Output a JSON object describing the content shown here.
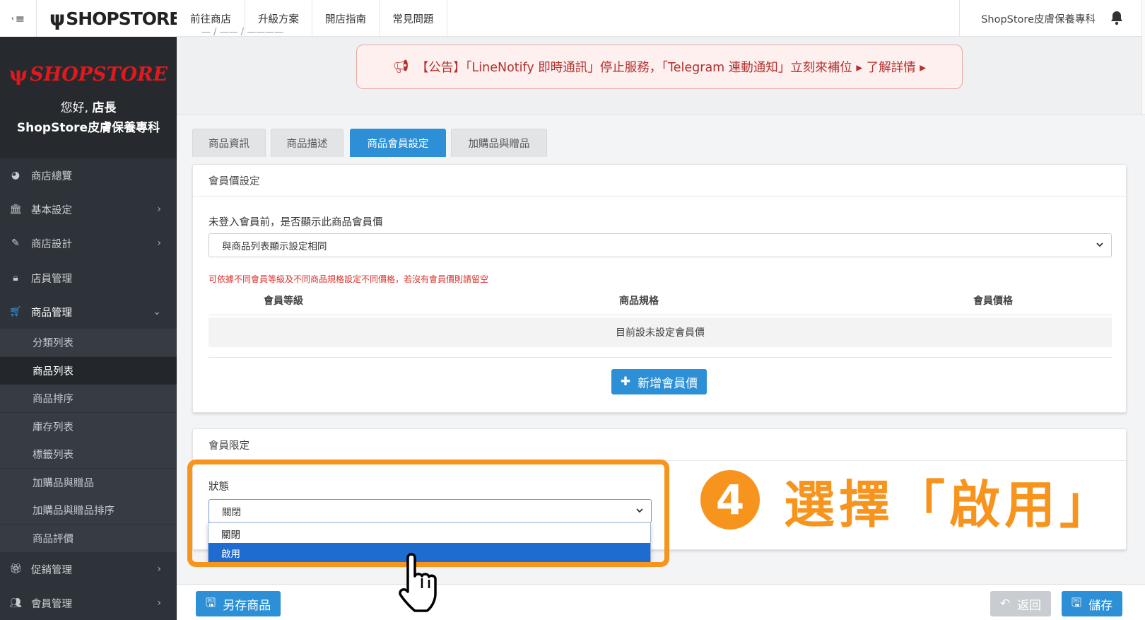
{
  "sidebar": {
    "toggle_icon": "menu-collapse-icon",
    "top_logo": "SHOPSTORE",
    "logo": "SHOPSTORE",
    "greeting": "您好,",
    "role": "店長",
    "shop_name": "ShopStore皮膚保養專科",
    "nav": [
      {
        "label": "商店總覽",
        "icon": "dashboard-icon"
      },
      {
        "label": "基本設定",
        "icon": "bank-icon"
      },
      {
        "label": "商店設計",
        "icon": "magic-wand-icon"
      },
      {
        "label": "店員管理",
        "icon": "lock-icon"
      },
      {
        "label": "商品管理",
        "icon": "cart-icon"
      }
    ],
    "sub": [
      {
        "label": "分類列表"
      },
      {
        "label": "商品列表"
      },
      {
        "label": "商品排序"
      },
      {
        "label": "庫存列表"
      },
      {
        "label": "標籤列表"
      },
      {
        "label": "加購品與贈品"
      },
      {
        "label": "加購品與贈品排序"
      },
      {
        "label": "商品評價"
      }
    ],
    "nav_bottom": [
      {
        "label": "促銷管理",
        "icon": "gift-icon"
      },
      {
        "label": "會員管理",
        "icon": "users-icon"
      }
    ]
  },
  "topbar": {
    "links": [
      "前往商店",
      "升級方案",
      "開店指南",
      "常見問題"
    ],
    "shop_name": "ShopStore皮膚保養專科"
  },
  "notice": {
    "text": "【公告】「LineNotify 即時通訊」停止服務，「Telegram 連動通知」立刻來補位 ▸ 了解詳情 ▸"
  },
  "tabs": [
    "商品資訊",
    "商品描述",
    "商品會員設定",
    "加購品與贈品"
  ],
  "member_price": {
    "title": "會員價設定",
    "question": "未登入會員前，是否顯示此商品會員價",
    "select_value": "與商品列表顯示設定相同",
    "hint": "可依據不同會員等級及不同商品規格設定不同價格，若沒有會員價則請留空",
    "columns": [
      "會員等級",
      "商品規格",
      "會員價格"
    ],
    "empty": "目前設未設定會員價",
    "add_button": "新增會員價"
  },
  "member_limit": {
    "title": "會員限定",
    "status_label": "狀態",
    "select_value": "關閉",
    "options": [
      "關閉",
      "啟用"
    ]
  },
  "annotation": {
    "number": "4",
    "text": "選擇「啟用」",
    "color": "#f7941d"
  },
  "bottom": {
    "save_as": "另存商品",
    "back": "返回",
    "save": "儲存"
  }
}
